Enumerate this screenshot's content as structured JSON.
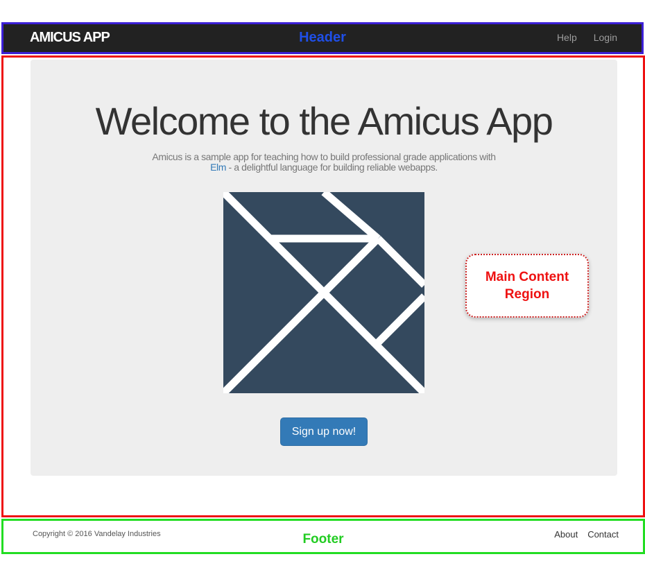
{
  "header": {
    "brand": "AMICUS APP",
    "nav": [
      {
        "label": "Help"
      },
      {
        "label": "Login"
      }
    ],
    "annotation": "Header"
  },
  "main": {
    "title": "Welcome to the Amicus App",
    "lead_text": "Amicus is a sample app for teaching how to build professional grade applications with",
    "lead_link": "Elm",
    "lead_suffix": " - a delightful language for building reliable webapps.",
    "logo_icon": "elm-tangram-logo-icon",
    "signup_button": "Sign up now!",
    "annotation_line1": "Main Content",
    "annotation_line2": "Region"
  },
  "footer": {
    "copyright": "Copyright © 2016 Vandelay Industries",
    "annotation": "Footer",
    "links": [
      {
        "label": "About"
      },
      {
        "label": "Contact"
      }
    ]
  },
  "colors": {
    "navbar": "#222222",
    "jumbotron": "#eeeeee",
    "primary_button": "#337ab7",
    "logo": "#34495e",
    "header_outline": "#3b1fd6",
    "main_outline": "#ee1111",
    "footer_outline": "#22dd22"
  }
}
